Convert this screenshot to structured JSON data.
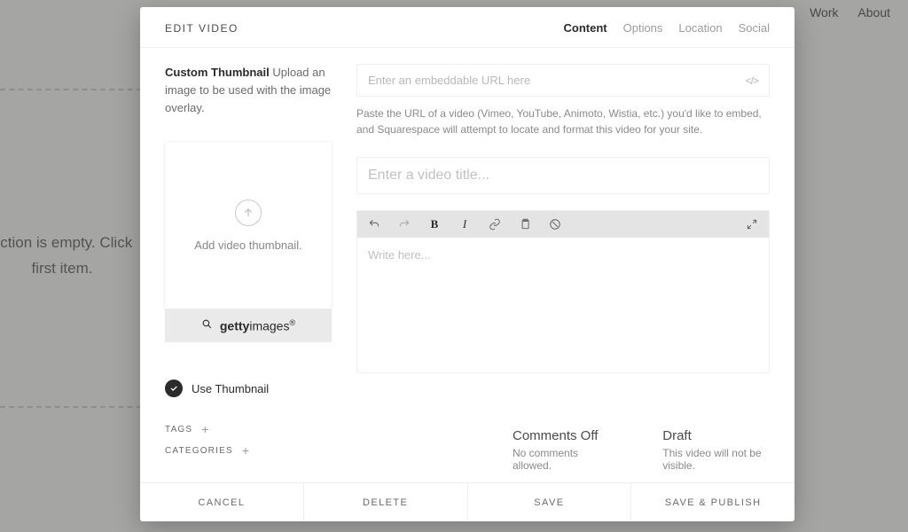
{
  "backdrop": {
    "nav": {
      "work": "Work",
      "about": "About"
    },
    "empty_line1": "ection is empty. Click",
    "empty_line2": "first item."
  },
  "modal": {
    "title": "EDIT VIDEO",
    "tabs": {
      "content": "Content",
      "options": "Options",
      "location": "Location",
      "social": "Social"
    }
  },
  "left": {
    "thumb_label_strong": "Custom Thumbnail",
    "thumb_label_rest": " Upload an image to be used with the image overlay.",
    "add_thumb": "Add video thumbnail.",
    "getty_bold": "getty",
    "getty_light": "images",
    "use_thumb": "Use Thumbnail",
    "tags": "TAGS",
    "categories": "CATEGORIES"
  },
  "right": {
    "url_placeholder": "Enter an embeddable URL here",
    "url_help": "Paste the URL of a video (Vimeo, YouTube, Animoto, Wistia, etc.) you'd like to embed, and Squarespace will attempt to locate and format this video for your site.",
    "title_placeholder": "Enter a video title...",
    "editor_placeholder": "Write here..."
  },
  "status": {
    "comments_title": "Comments Off",
    "comments_sub": "No comments allowed.",
    "draft_title": "Draft",
    "draft_sub": "This video will not be visible."
  },
  "footer": {
    "cancel": "CANCEL",
    "delete": "DELETE",
    "save": "SAVE",
    "save_publish": "SAVE & PUBLISH"
  }
}
